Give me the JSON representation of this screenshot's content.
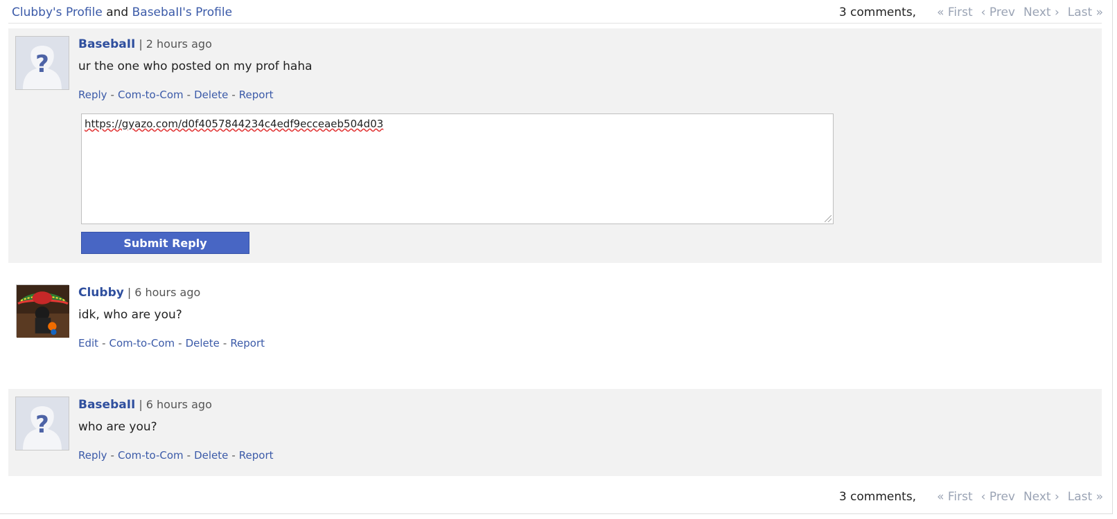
{
  "header": {
    "profile_a": "Clubby's Profile",
    "and": "and",
    "profile_b": "BasebaII's Profile"
  },
  "pager": {
    "count": "3 comments,",
    "first": "« First",
    "prev": "‹ Prev",
    "next": "Next ›",
    "last": "Last »"
  },
  "comments": [
    {
      "author": "BasebaII",
      "sep": "|",
      "time": "2 hours ago",
      "body": "ur the one who posted on my prof haha",
      "avatar": "default-avatar-icon",
      "actions": [
        "Reply",
        "Com-to-Com",
        "Delete",
        "Report"
      ]
    },
    {
      "author": "Clubby",
      "sep": "|",
      "time": "6 hours ago",
      "body": "idk, who are you?",
      "avatar": "user-photo-avatar",
      "actions": [
        "Edit",
        "Com-to-Com",
        "Delete",
        "Report"
      ]
    },
    {
      "author": "BasebaII",
      "sep": "|",
      "time": "6 hours ago",
      "body": "who are you?",
      "avatar": "default-avatar-icon",
      "actions": [
        "Reply",
        "Com-to-Com",
        "Delete",
        "Report"
      ]
    }
  ],
  "reply": {
    "value": "https://gyazo.com/d0f4057844234c4edf9ecceaeb504d03",
    "submit_label": "Submit Reply"
  },
  "actions_dash": "-",
  "colors": {
    "link": "#3b5aa8",
    "author": "#2f4f9e",
    "button": "#4866c4",
    "shaded_row": "#f2f2f2",
    "pager_disabled": "#9aa3b4"
  }
}
